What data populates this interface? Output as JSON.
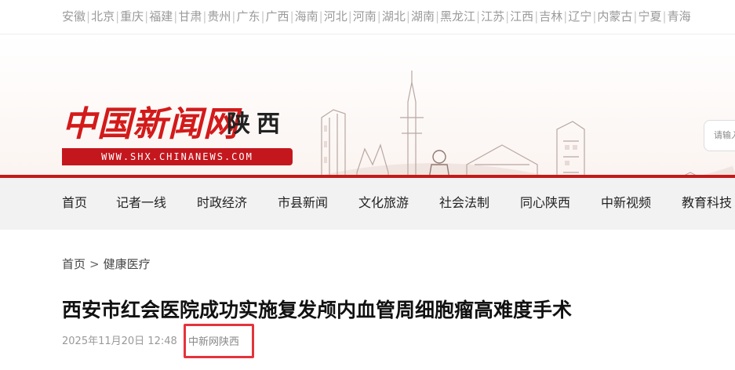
{
  "regions": [
    "安徽",
    "北京",
    "重庆",
    "福建",
    "甘肃",
    "贵州",
    "广东",
    "广西",
    "海南",
    "河北",
    "河南",
    "湖北",
    "湖南",
    "黑龙江",
    "江苏",
    "江西",
    "吉林",
    "辽宁",
    "内蒙古",
    "宁夏",
    "青海"
  ],
  "header": {
    "logo_text": "中国新闻网",
    "region_name": "陕西",
    "url_text": "WWW.SHX.CHINANEWS.COM",
    "search_placeholder": "请输入"
  },
  "nav": [
    {
      "label": "首页"
    },
    {
      "label": "记者一线"
    },
    {
      "label": "时政经济"
    },
    {
      "label": "市县新闻"
    },
    {
      "label": "文化旅游"
    },
    {
      "label": "社会法制"
    },
    {
      "label": "同心陕西"
    },
    {
      "label": "中新视频"
    },
    {
      "label": "教育科技"
    }
  ],
  "breadcrumb": {
    "home": "首页",
    "separator": ">",
    "current": "健康医疗"
  },
  "article": {
    "title": "西安市红会医院成功实施复发颅内血管周细胞瘤高难度手术",
    "date": "2025年11月20日 12:48",
    "source": "中新网陕西"
  },
  "colors": {
    "brand_red": "#c4171d",
    "highlight_box": "#e5333b",
    "nav_bg": "#f2f2f2"
  }
}
